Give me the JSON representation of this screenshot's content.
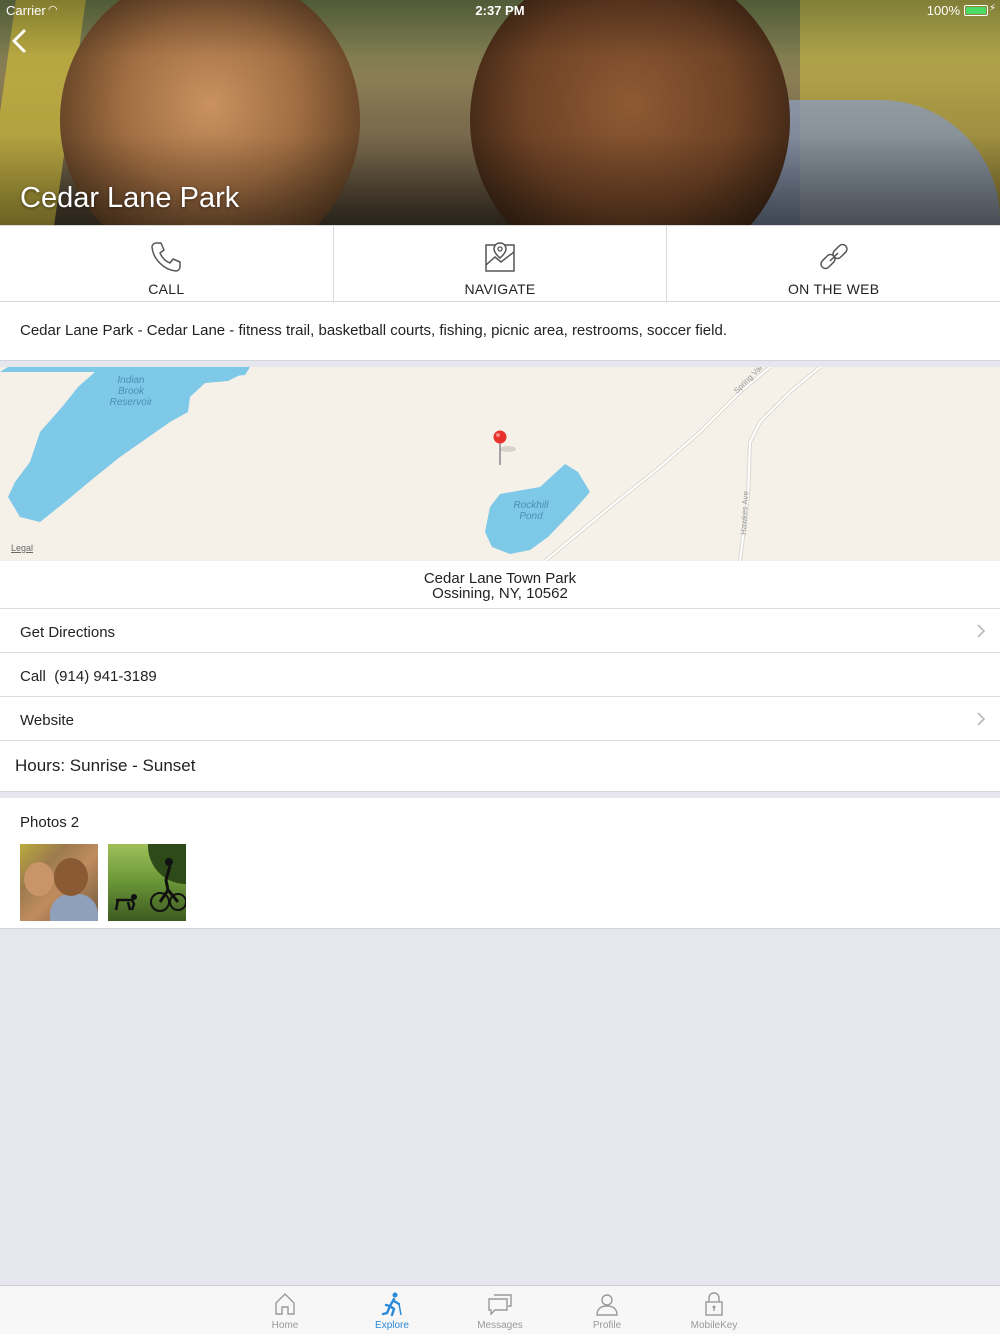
{
  "status_bar": {
    "carrier": "Carrier",
    "time": "2:37 PM",
    "battery": "100%"
  },
  "hero": {
    "title": "Cedar Lane Park"
  },
  "actions": [
    {
      "label": "CALL",
      "icon": "phone-icon"
    },
    {
      "label": "NAVIGATE",
      "icon": "map-pin-icon"
    },
    {
      "label": "ON THE WEB",
      "icon": "link-icon"
    }
  ],
  "description": "Cedar Lane Park - Cedar Lane - fitness trail, basketball courts, fishing, picnic area, restrooms, soccer field.",
  "map": {
    "labels": {
      "reservoir": [
        "Indian",
        "Brook",
        "Reservoir"
      ],
      "pond": [
        "Rockhill",
        "Pond"
      ],
      "road1": "Spring Val",
      "road2": "Hawkes Ave"
    },
    "legal": "Legal"
  },
  "address": {
    "name": "Cedar Lane Town Park",
    "line2": "Ossining, NY, 10562"
  },
  "rows": {
    "directions": "Get Directions",
    "call_prefix": "Call",
    "phone": "(914) 941-3189",
    "website": "Website"
  },
  "hours": "Hours: Sunrise - Sunset",
  "photos": {
    "title": "Photos",
    "count": "2"
  },
  "tabbar": [
    {
      "label": "Home",
      "icon": "home-icon",
      "active": false
    },
    {
      "label": "Explore",
      "icon": "explore-icon",
      "active": true
    },
    {
      "label": "Messages",
      "icon": "messages-icon",
      "active": false
    },
    {
      "label": "Profile",
      "icon": "profile-icon",
      "active": false
    },
    {
      "label": "MobileKey",
      "icon": "lock-icon",
      "active": false
    }
  ],
  "colors": {
    "accent": "#2b8ad8",
    "water": "#7ec8e8",
    "pin": "#e8312c",
    "map_bg": "#f5f1e9"
  }
}
